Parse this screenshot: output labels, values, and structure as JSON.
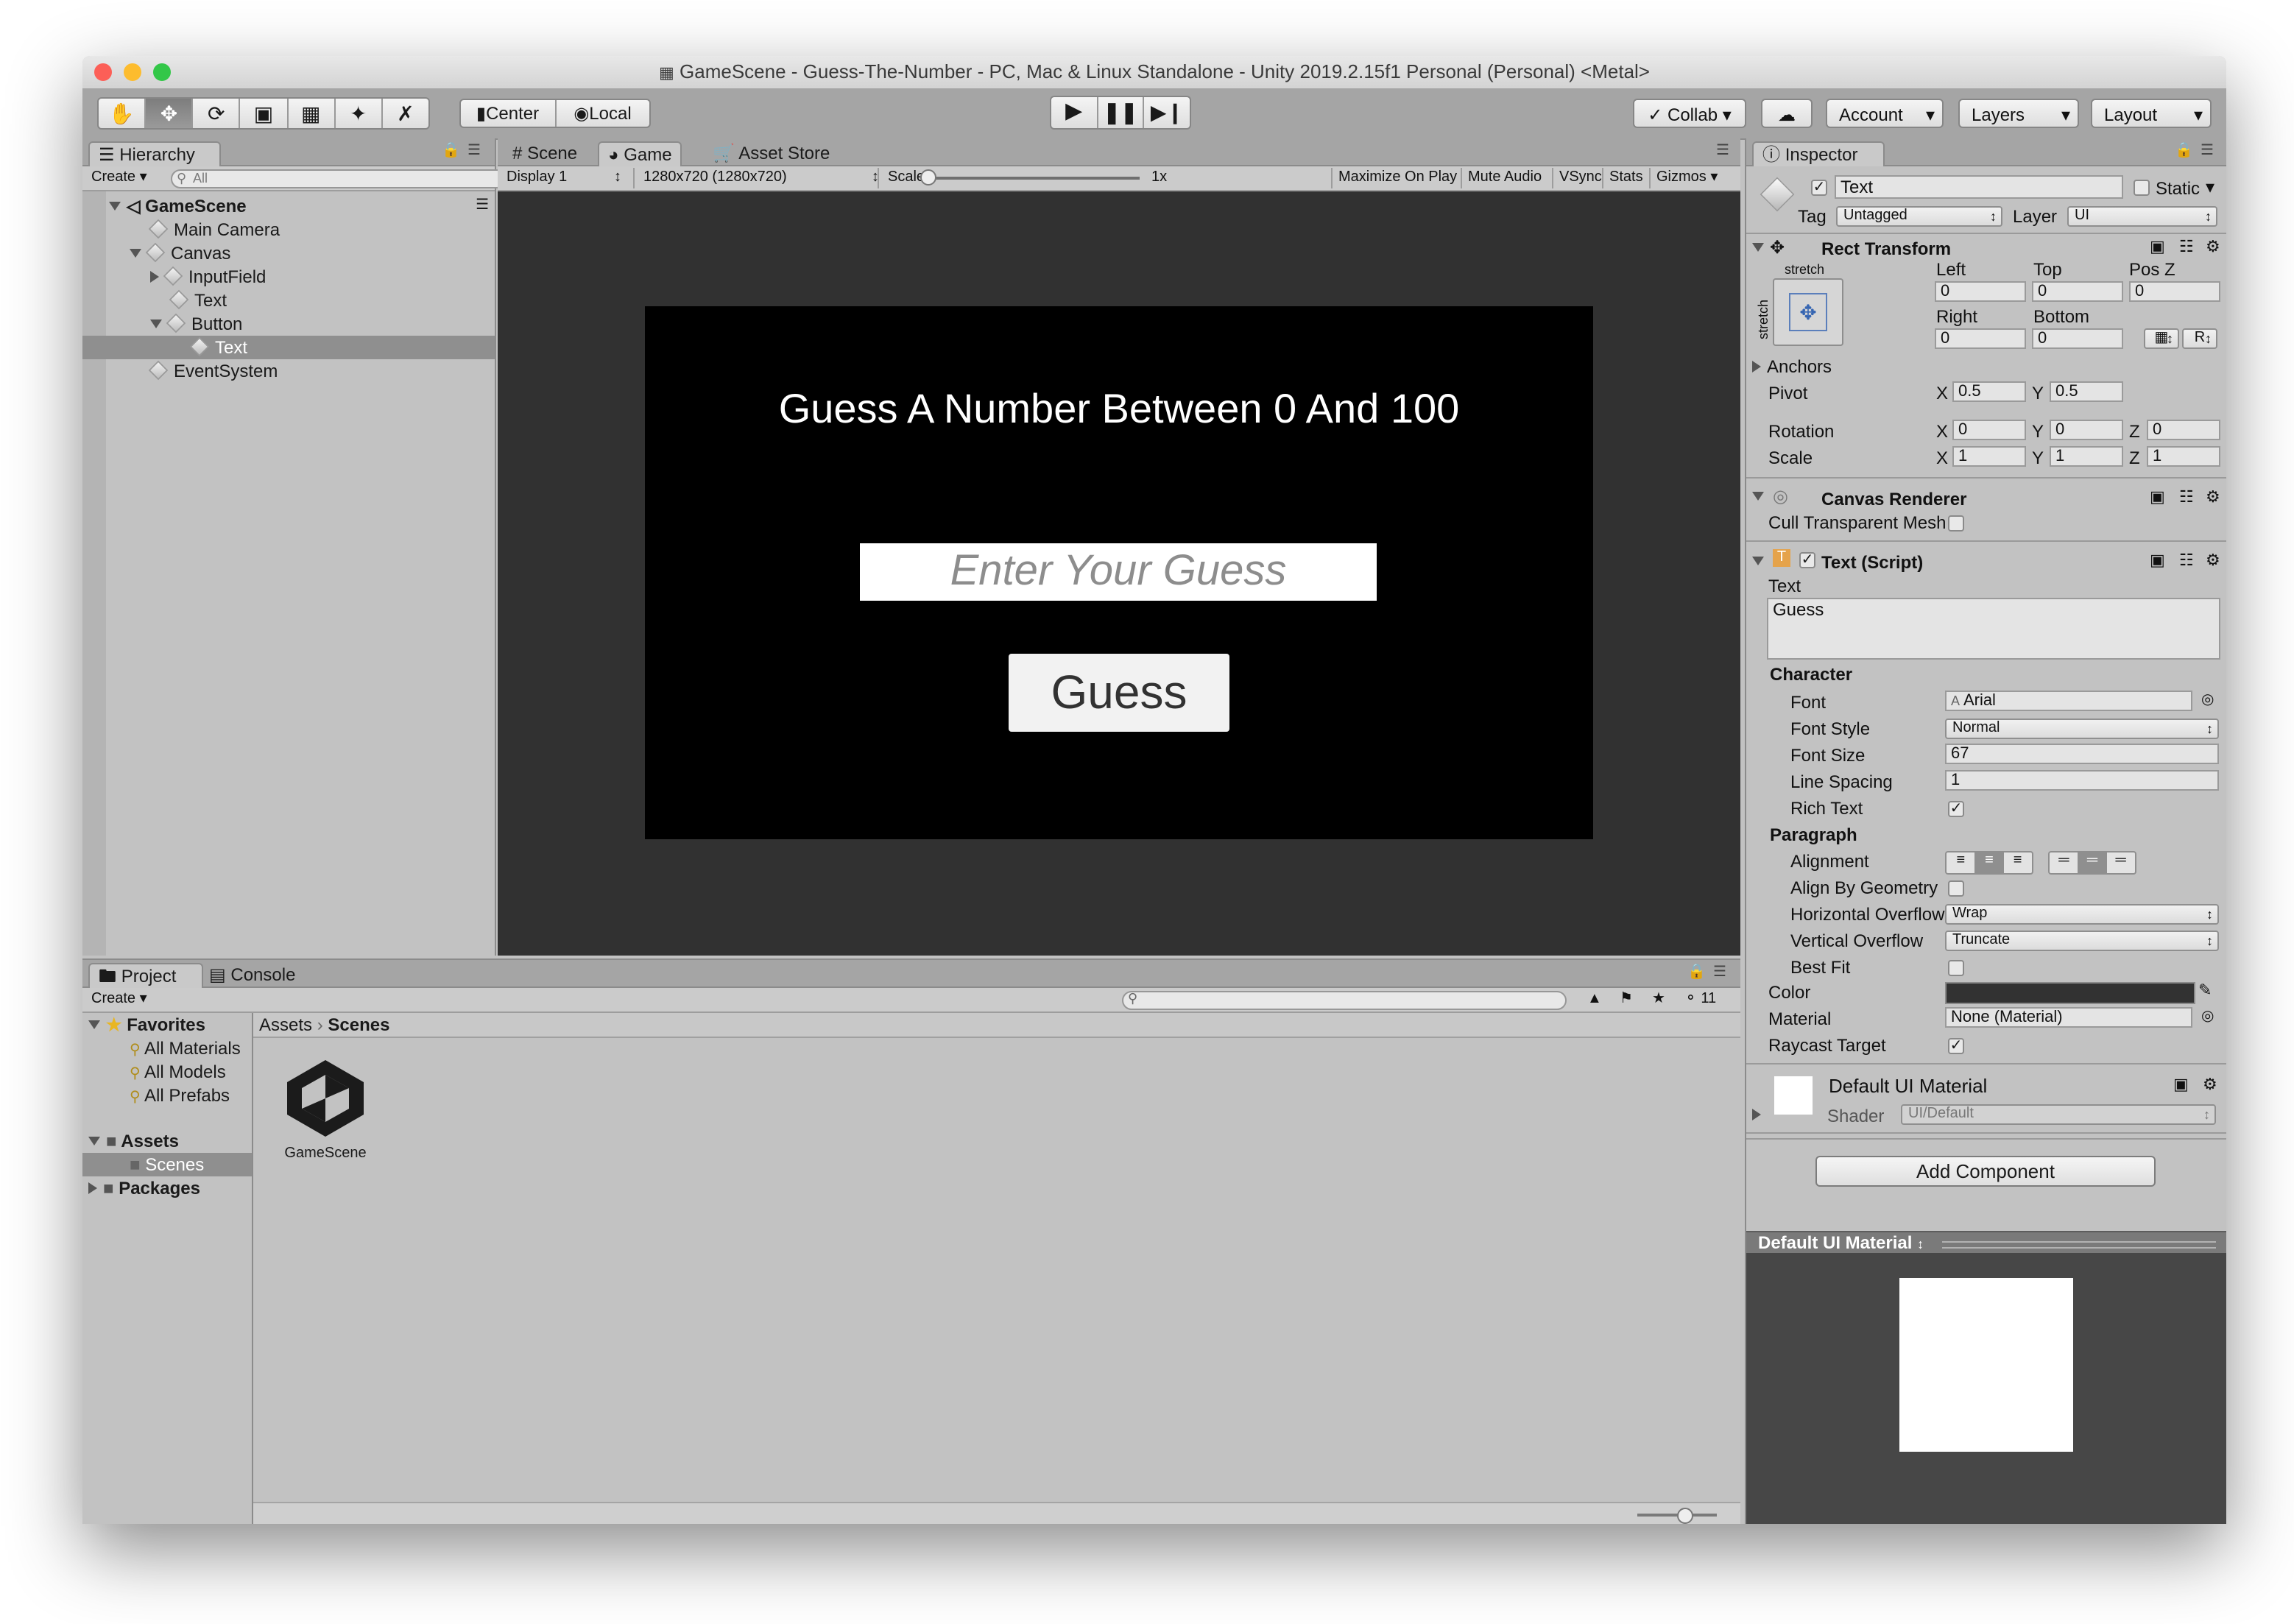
{
  "window": {
    "title": "GameScene - Guess-The-Number - PC, Mac & Linux Standalone - Unity 2019.2.15f1 Personal (Personal) <Metal>"
  },
  "toolbar": {
    "tools": [
      "hand-tool",
      "move-tool",
      "rotate-tool",
      "scale-tool",
      "rect-tool",
      "transform-tool",
      "custom-tool"
    ],
    "pivot_label": "Center",
    "space_label": "Local",
    "collab_label": "Collab",
    "account_label": "Account",
    "layers_label": "Layers",
    "layout_label": "Layout"
  },
  "hierarchy": {
    "tab_label": "Hierarchy",
    "create_label": "Create",
    "search_placeholder": "All",
    "scene_name": "GameScene",
    "items": [
      {
        "label": "Main Camera"
      },
      {
        "label": "Canvas"
      },
      {
        "label": "InputField"
      },
      {
        "label": "Text"
      },
      {
        "label": "Button"
      },
      {
        "label": "Text"
      },
      {
        "label": "EventSystem"
      }
    ]
  },
  "center_tabs": {
    "scene": "Scene",
    "game": "Game",
    "asset_store": "Asset Store"
  },
  "game_toolbar": {
    "display": "Display 1",
    "resolution": "1280x720 (1280x720)",
    "scale_label": "Scale",
    "scale_value": "1x",
    "scale_slider_position": 0.0,
    "maximize": "Maximize On Play",
    "mute": "Mute Audio",
    "vsync": "VSync",
    "stats": "Stats",
    "gizmos": "Gizmos"
  },
  "game_view": {
    "heading": "Guess A Number Between 0 And 100",
    "input_placeholder": "Enter Your Guess",
    "button_label": "Guess"
  },
  "project": {
    "tab_project": "Project",
    "tab_console": "Console",
    "create_label": "Create",
    "hidden_count": "11",
    "favorites_label": "Favorites",
    "favorites": [
      "All Materials",
      "All Models",
      "All Prefabs"
    ],
    "assets_label": "Assets",
    "scenes_label": "Scenes",
    "packages_label": "Packages",
    "breadcrumb": [
      "Assets",
      "Scenes"
    ],
    "asset_items": [
      {
        "label": "GameScene"
      }
    ]
  },
  "inspector": {
    "tab_label": "Inspector",
    "object_name": "Text",
    "static_label": "Static",
    "tag_label": "Tag",
    "tag_value": "Untagged",
    "layer_label": "Layer",
    "layer_value": "UI",
    "rect_transform": {
      "title": "Rect Transform",
      "stretch_h": "stretch",
      "stretch_v": "stretch",
      "left_label": "Left",
      "left": "0",
      "top_label": "Top",
      "top": "0",
      "posz_label": "Pos Z",
      "posz": "0",
      "right_label": "Right",
      "right": "0",
      "bottom_label": "Bottom",
      "bottom": "0",
      "r_button": "R",
      "anchors_label": "Anchors",
      "pivot_label": "Pivot",
      "pivot_x": "0.5",
      "pivot_y": "0.5",
      "rotation_label": "Rotation",
      "rot_x": "0",
      "rot_y": "0",
      "rot_z": "0",
      "scale_label": "Scale",
      "scale_x": "1",
      "scale_y": "1",
      "scale_z": "1",
      "x_label": "X",
      "y_label": "Y",
      "z_label": "Z"
    },
    "canvas_renderer": {
      "title": "Canvas Renderer",
      "cull_label": "Cull Transparent Mesh"
    },
    "text_script": {
      "title": "Text (Script)",
      "text_label": "Text",
      "text_value": "Guess",
      "character_label": "Character",
      "font_label": "Font",
      "font_value": "Arial",
      "font_style_label": "Font Style",
      "font_style_value": "Normal",
      "font_size_label": "Font Size",
      "font_size_value": "67",
      "line_spacing_label": "Line Spacing",
      "line_spacing_value": "1",
      "rich_text_label": "Rich Text",
      "paragraph_label": "Paragraph",
      "alignment_label": "Alignment",
      "align_geometry_label": "Align By Geometry",
      "h_overflow_label": "Horizontal Overflow",
      "h_overflow_value": "Wrap",
      "v_overflow_label": "Vertical Overflow",
      "v_overflow_value": "Truncate",
      "best_fit_label": "Best Fit",
      "color_label": "Color",
      "color_value": "#323232",
      "material_label": "Material",
      "material_value": "None (Material)",
      "raycast_label": "Raycast Target"
    },
    "material": {
      "name": "Default UI Material",
      "shader_label": "Shader",
      "shader_value": "UI/Default"
    },
    "add_component": "Add Component",
    "preview_title": "Default UI Material"
  },
  "colors": {
    "close": "#fc5f57",
    "minimize": "#fdbc2e",
    "zoom": "#33c748",
    "selection": "#8f8f8f",
    "game_bg": "#313131"
  }
}
